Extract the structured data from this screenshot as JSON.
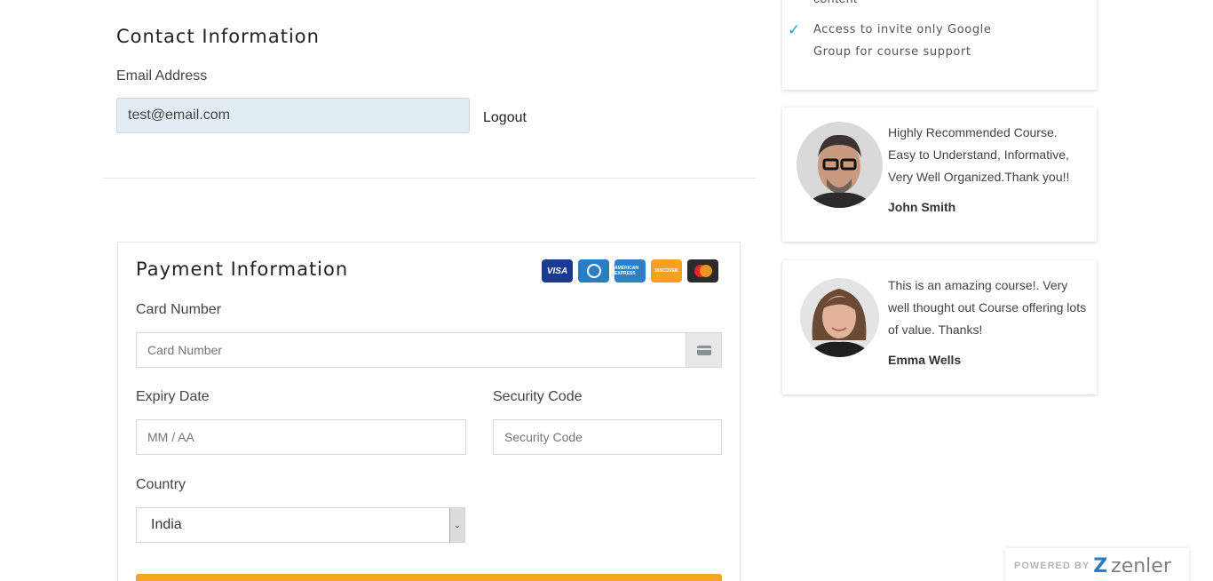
{
  "contact": {
    "title": "Contact Information",
    "email_label": "Email Address",
    "email_value": "test@email.com",
    "logout_label": "Logout"
  },
  "payment": {
    "title": "Payment Information",
    "card_brands": [
      "VISA",
      "Diners Club",
      "AMERICAN EXPRESS",
      "DISCOVER",
      "Mastercard"
    ],
    "card_number_label": "Card Number",
    "card_number_placeholder": "Card Number",
    "expiry_label": "Expiry Date",
    "expiry_placeholder": "MM / AA",
    "security_label": "Security Code",
    "security_placeholder": "Security Code",
    "country_label": "Country",
    "country_value": "India"
  },
  "benefits": {
    "cut_text": "content",
    "item": "Access to invite only Google Group for course support"
  },
  "testimonials": [
    {
      "quote": "Highly Recommended Course. Easy to Understand, Informative, Very Well Organized.Thank you!!",
      "name": "John Smith"
    },
    {
      "quote": "This is an amazing course!. Very well thought out Course offering lots of value. Thanks!",
      "name": "Emma Wells"
    }
  ],
  "footer": {
    "powered_label": "POWERED BY",
    "brand": "zenler"
  },
  "colors": {
    "accent": "#f5a623",
    "check": "#2a9fd6",
    "email_bg": "#e2edf2"
  },
  "icons": [
    "check-icon",
    "credit-card-icon",
    "chevron-down-icon",
    "zenler-logo-icon"
  ]
}
